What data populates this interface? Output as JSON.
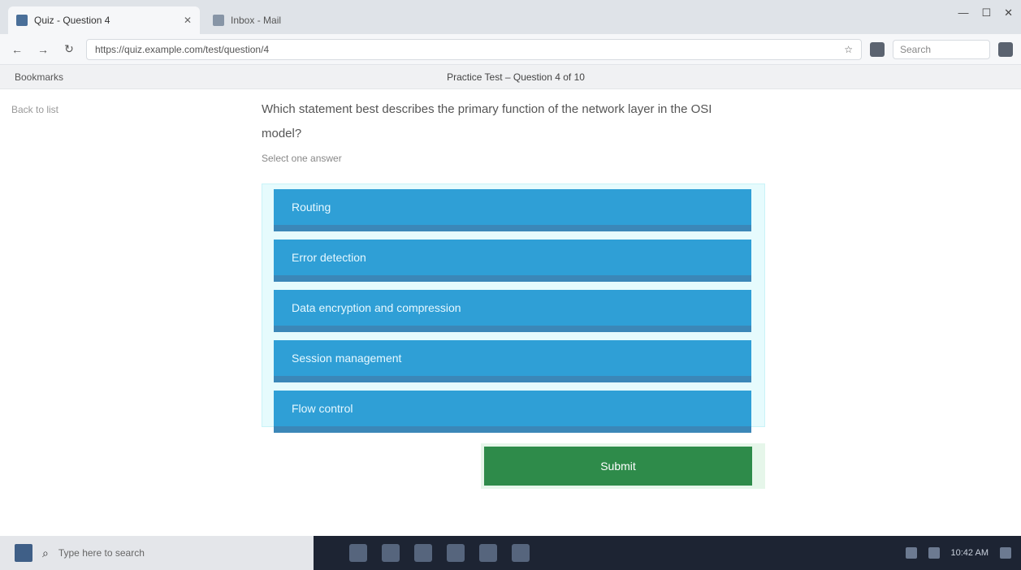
{
  "browser": {
    "tabs": [
      {
        "title": "Quiz - Question 4",
        "active": true
      },
      {
        "title": "Inbox - Mail",
        "active": false
      }
    ],
    "url": "https://quiz.example.com/test/question/4",
    "search_placeholder": "Search",
    "bookmarks_left": "Bookmarks",
    "page_banner": "Practice Test – Question 4 of 10"
  },
  "page": {
    "left_link": "Back to list",
    "question": "Which statement best describes the primary function of the network layer in the OSI model?",
    "subhead": "Select one answer",
    "options": [
      "Routing",
      "Error detection",
      "Data encryption and compression",
      "Session management",
      "Flow control"
    ],
    "submit_label": "Submit"
  },
  "taskbar": {
    "search_text": "Type here to search",
    "clock": "10:42 AM"
  },
  "colors": {
    "option_bg": "#2f9fd6",
    "option_panel": "#e6fbfd",
    "submit_bg": "#2e8b4a",
    "taskbar_bg": "#1d2433"
  }
}
